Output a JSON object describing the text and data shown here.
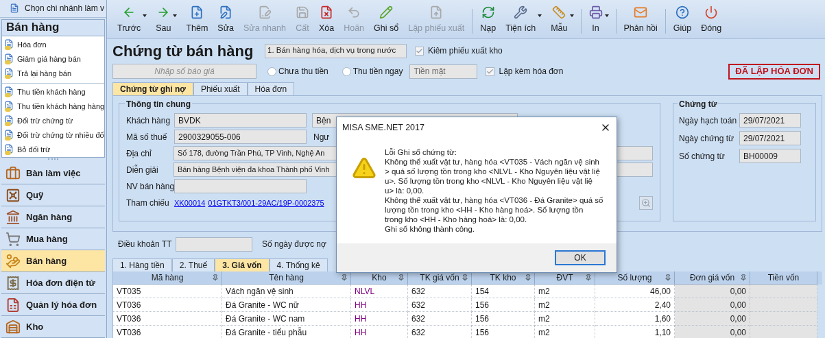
{
  "branch_bar": {
    "label": "Chọn chi nhánh làm v"
  },
  "sidebar": {
    "title": "Bán hàng",
    "item_groups": [
      {
        "items": [
          "Hóa đơn",
          "Giảm giá hàng bán",
          "Trả lại hàng bán"
        ]
      },
      {
        "items": [
          "Thu tiền khách hàng",
          "Thu tiền khách hàng hàng",
          "Đối trừ chứng từ",
          "Đối trừ chứng từ nhiều đố",
          "Bỏ đối trừ"
        ]
      }
    ]
  },
  "modules": [
    {
      "label": "Bàn làm việc",
      "selected": false
    },
    {
      "label": "Quỹ",
      "selected": false
    },
    {
      "label": "Ngân hàng",
      "selected": false
    },
    {
      "label": "Mua hàng",
      "selected": false
    },
    {
      "label": "Bán hàng",
      "selected": true
    },
    {
      "label": "Hóa đơn điện tử",
      "selected": false
    },
    {
      "label": "Quản lý hóa đơn",
      "selected": false
    },
    {
      "label": "Kho",
      "selected": false
    }
  ],
  "toolbar": [
    {
      "label": "Trước",
      "disabled": false,
      "dropdown": true,
      "separator_before": false
    },
    {
      "label": "Sau",
      "disabled": false,
      "dropdown": true,
      "separator_before": false
    },
    {
      "label": "Thêm",
      "disabled": false,
      "dropdown": false,
      "separator_before": false
    },
    {
      "label": "Sửa",
      "disabled": false,
      "dropdown": false,
      "separator_before": false
    },
    {
      "label": "Sửa nhanh",
      "disabled": true,
      "dropdown": false,
      "separator_before": false
    },
    {
      "label": "Cất",
      "disabled": true,
      "dropdown": false,
      "separator_before": false
    },
    {
      "label": "Xóa",
      "disabled": false,
      "dropdown": false,
      "separator_before": false
    },
    {
      "label": "Hoãn",
      "disabled": true,
      "dropdown": false,
      "separator_before": false
    },
    {
      "label": "Ghi sổ",
      "disabled": false,
      "dropdown": false,
      "separator_before": false
    },
    {
      "label": "Lập phiếu xuất",
      "disabled": true,
      "dropdown": false,
      "separator_before": false
    },
    {
      "label": "Nạp",
      "disabled": false,
      "dropdown": false,
      "separator_before": true
    },
    {
      "label": "Tiện ích",
      "disabled": false,
      "dropdown": true,
      "separator_before": false
    },
    {
      "label": "Mẫu",
      "disabled": false,
      "dropdown": true,
      "separator_before": false
    },
    {
      "label": "In",
      "disabled": false,
      "dropdown": true,
      "separator_before": true
    },
    {
      "label": "Phản hồi",
      "disabled": false,
      "dropdown": false,
      "separator_before": true
    },
    {
      "label": "Giúp",
      "disabled": false,
      "dropdown": false,
      "separator_before": true
    },
    {
      "label": "Đóng",
      "disabled": false,
      "dropdown": false,
      "separator_before": false
    }
  ],
  "form": {
    "title": "Chứng từ bán hàng",
    "type_select": {
      "value": "1. Bán hàng hóa, dịch vụ trong nước"
    },
    "export_checkbox": {
      "label": "Kiêm phiếu xuất kho",
      "checked": true
    },
    "quote_field": {
      "placeholder": "Nhập số báo giá"
    },
    "payment_options": [
      {
        "label": "Chưa thu tiền",
        "selected": false
      },
      {
        "label": "Thu tiền ngay",
        "selected": false
      }
    ],
    "payment_method": {
      "value": "Tiền mặt"
    },
    "invoice_checkbox": {
      "label": "Lập kèm hóa đơn",
      "checked": true
    },
    "status_stamp": "ĐÃ LẬP HÓA ĐƠN"
  },
  "tabs": [
    {
      "label": "Chứng từ ghi nợ",
      "selected": true
    },
    {
      "label": "Phiếu xuất",
      "selected": false
    },
    {
      "label": "Hóa đơn",
      "selected": false
    }
  ],
  "general_info": {
    "title": "Thông tin chung",
    "customer": {
      "label": "Khách hàng",
      "code": "BVDK",
      "name": "Bện"
    },
    "tax_code": {
      "label": "Mã số thuế",
      "value": "2900329055-006",
      "side_label": "Ngư"
    },
    "address": {
      "label": "Địa chỉ",
      "value": "Số 178, đường Trần Phú, TP Vinh, Nghệ An"
    },
    "description": {
      "label": "Diễn giải",
      "value": "Bán hàng Bệnh viện đa khoa Thành phố Vinh"
    },
    "salesperson": {
      "label": "NV bán hàng"
    },
    "reference": {
      "label": "Tham chiếu",
      "links": [
        "XK00014",
        "01GTKT3/001-29AC/19P-0002375"
      ]
    }
  },
  "voucher": {
    "title": "Chứng từ",
    "fields": [
      {
        "label": "Ngày hạch toán",
        "value": "29/07/2021"
      },
      {
        "label": "Ngày chứng từ",
        "value": "29/07/2021"
      },
      {
        "label": "Số chứng từ",
        "value": "BH00009"
      }
    ]
  },
  "terms": {
    "label": "Điều khoản TT",
    "days_label": "Số ngày được nợ"
  },
  "detail_tabs": [
    {
      "label": "1. Hàng tiền",
      "selected": false
    },
    {
      "label": "2. Thuế",
      "selected": false
    },
    {
      "label": "3. Giá vốn",
      "selected": true
    },
    {
      "label": "4. Thống kê",
      "selected": false
    }
  ],
  "table": {
    "columns": [
      {
        "label": "Mã hàng",
        "kind": "text"
      },
      {
        "label": "Tên hàng",
        "kind": "text"
      },
      {
        "label": "Kho",
        "kind": "lookup"
      },
      {
        "label": "TK giá vốn",
        "kind": "text"
      },
      {
        "label": "TK kho",
        "kind": "text"
      },
      {
        "label": "ĐVT",
        "kind": "text"
      },
      {
        "label": "Số lượng",
        "kind": "number"
      },
      {
        "label": "Đơn giá vốn",
        "kind": "computed"
      },
      {
        "label": "Tiền vốn",
        "kind": "computed"
      }
    ],
    "rows": [
      [
        "VT035",
        "Vách ngăn vệ sinh",
        "NLVL",
        "632",
        "154",
        "m2",
        "46,00",
        "0,00",
        ""
      ],
      [
        "VT036",
        "Đá Granite - WC nữ",
        "HH",
        "632",
        "156",
        "m2",
        "2,40",
        "0,00",
        ""
      ],
      [
        "VT036",
        "Đá Granite - WC nam",
        "HH",
        "632",
        "156",
        "m2",
        "1,60",
        "0,00",
        ""
      ],
      [
        "VT036",
        "Đá Granite - tiểu phẫu",
        "HH",
        "632",
        "156",
        "m2",
        "1,10",
        "0,00",
        ""
      ]
    ]
  },
  "dialog": {
    "title": "MISA SME.NET 2017",
    "message_lines": [
      "Lỗi Ghi sổ chứng từ:",
      "Không thể xuất vật tư, hàng hóa <VT035 - Vách ngăn vệ sinh",
      "> quá số lượng tồn trong kho <NLVL - Kho Nguyên liệu vật liệ",
      "u>. Số lượng tồn trong kho <NLVL - Kho Nguyên liệu vật liệ",
      "u> là: 0,00.",
      "Không thể xuất vật tư, hàng hóa <VT036 - Đá Granite> quá số",
      "lượng tồn trong kho <HH - Kho hàng hoá>. Số lượng tồn",
      "trong kho <HH - Kho hàng hoá> là: 0,00.",
      "Ghi sổ không thành công."
    ],
    "ok_button": "OK"
  }
}
